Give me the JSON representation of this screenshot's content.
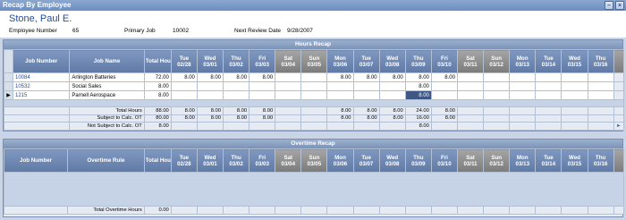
{
  "window": {
    "title": "Recap By Employee"
  },
  "employee": {
    "name": "Stone, Paul E.",
    "number_label": "Employee Number",
    "number": "65",
    "primary_job_label": "Primary Job",
    "primary_job": "10002",
    "review_label": "Next Review Date",
    "review_date": "9/28/2007"
  },
  "hours_recap": {
    "title": "Hours Recap",
    "columns": {
      "job_number": "Job Number",
      "job_name": "Job Name",
      "total_hours": "Total Hours"
    },
    "days": [
      {
        "dow": "Tue",
        "date": "02/28"
      },
      {
        "dow": "Wed",
        "date": "03/01"
      },
      {
        "dow": "Thu",
        "date": "03/02"
      },
      {
        "dow": "Fri",
        "date": "03/03"
      },
      {
        "dow": "Sat",
        "date": "03/04"
      },
      {
        "dow": "Sun",
        "date": "03/05"
      },
      {
        "dow": "Mon",
        "date": "03/06"
      },
      {
        "dow": "Tue",
        "date": "03/07"
      },
      {
        "dow": "Wed",
        "date": "03/08"
      },
      {
        "dow": "Thu",
        "date": "03/09"
      },
      {
        "dow": "Fri",
        "date": "03/10"
      },
      {
        "dow": "Sat",
        "date": "03/11"
      },
      {
        "dow": "Sun",
        "date": "03/12"
      },
      {
        "dow": "Mon",
        "date": "03/13"
      },
      {
        "dow": "Tue",
        "date": "03/14"
      },
      {
        "dow": "Wed",
        "date": "03/15"
      },
      {
        "dow": "Thu",
        "date": "03/16"
      }
    ],
    "rows": [
      {
        "job_number": "10084",
        "job_name": "Arlington Batteries",
        "total": "72.00",
        "values": [
          "8.00",
          "8.00",
          "8.00",
          "8.00",
          "",
          "",
          "8.00",
          "8.00",
          "8.00",
          "8.00",
          "8.00",
          "",
          "",
          "",
          "",
          "",
          ""
        ]
      },
      {
        "job_number": "10532",
        "job_name": "Social Sales",
        "total": "8.00",
        "values": [
          "",
          "",
          "",
          "",
          "",
          "",
          "",
          "",
          "",
          "8.00",
          "",
          "",
          "",
          "",
          "",
          "",
          ""
        ]
      },
      {
        "job_number": "1215",
        "job_name": "Parnell Aerospace",
        "total": "8.00",
        "values": [
          "",
          "",
          "",
          "",
          "",
          "",
          "",
          "",
          "",
          "8.00",
          "",
          "",
          "",
          "",
          "",
          "",
          ""
        ]
      }
    ],
    "current_row_marker": "▶",
    "totals": [
      {
        "label": "Total Hours",
        "total": "88.00",
        "values": [
          "8.00",
          "8.00",
          "8.00",
          "8.00",
          "",
          "",
          "8.00",
          "8.00",
          "8.00",
          "24.00",
          "8.00",
          "",
          "",
          "",
          "",
          "",
          ""
        ]
      },
      {
        "label": "Subject to Calc. OT",
        "total": "80.00",
        "values": [
          "8.00",
          "8.00",
          "8.00",
          "8.00",
          "",
          "",
          "8.00",
          "8.00",
          "8.00",
          "16.00",
          "8.00",
          "",
          "",
          "",
          "",
          "",
          ""
        ]
      },
      {
        "label": "Not Subject to Calc. OT",
        "total": "8.00",
        "values": [
          "",
          "",
          "",
          "",
          "",
          "",
          "",
          "",
          "",
          "8.00",
          "",
          "",
          "",
          "",
          "",
          "",
          ""
        ]
      }
    ]
  },
  "overtime_recap": {
    "title": "Overtime Recap",
    "columns": {
      "job_number": "Job Number",
      "overtime_rule": "Overtime Rule",
      "total_hours": "Total Hours"
    },
    "totals": {
      "label": "Total Overtime Hours",
      "total": "0.00"
    }
  },
  "colors": {
    "accent": "#1f4fa0",
    "header_blue": "#6b86b0",
    "weekend_gray": "#8c8c8c",
    "today_green": "#2aa04a"
  }
}
